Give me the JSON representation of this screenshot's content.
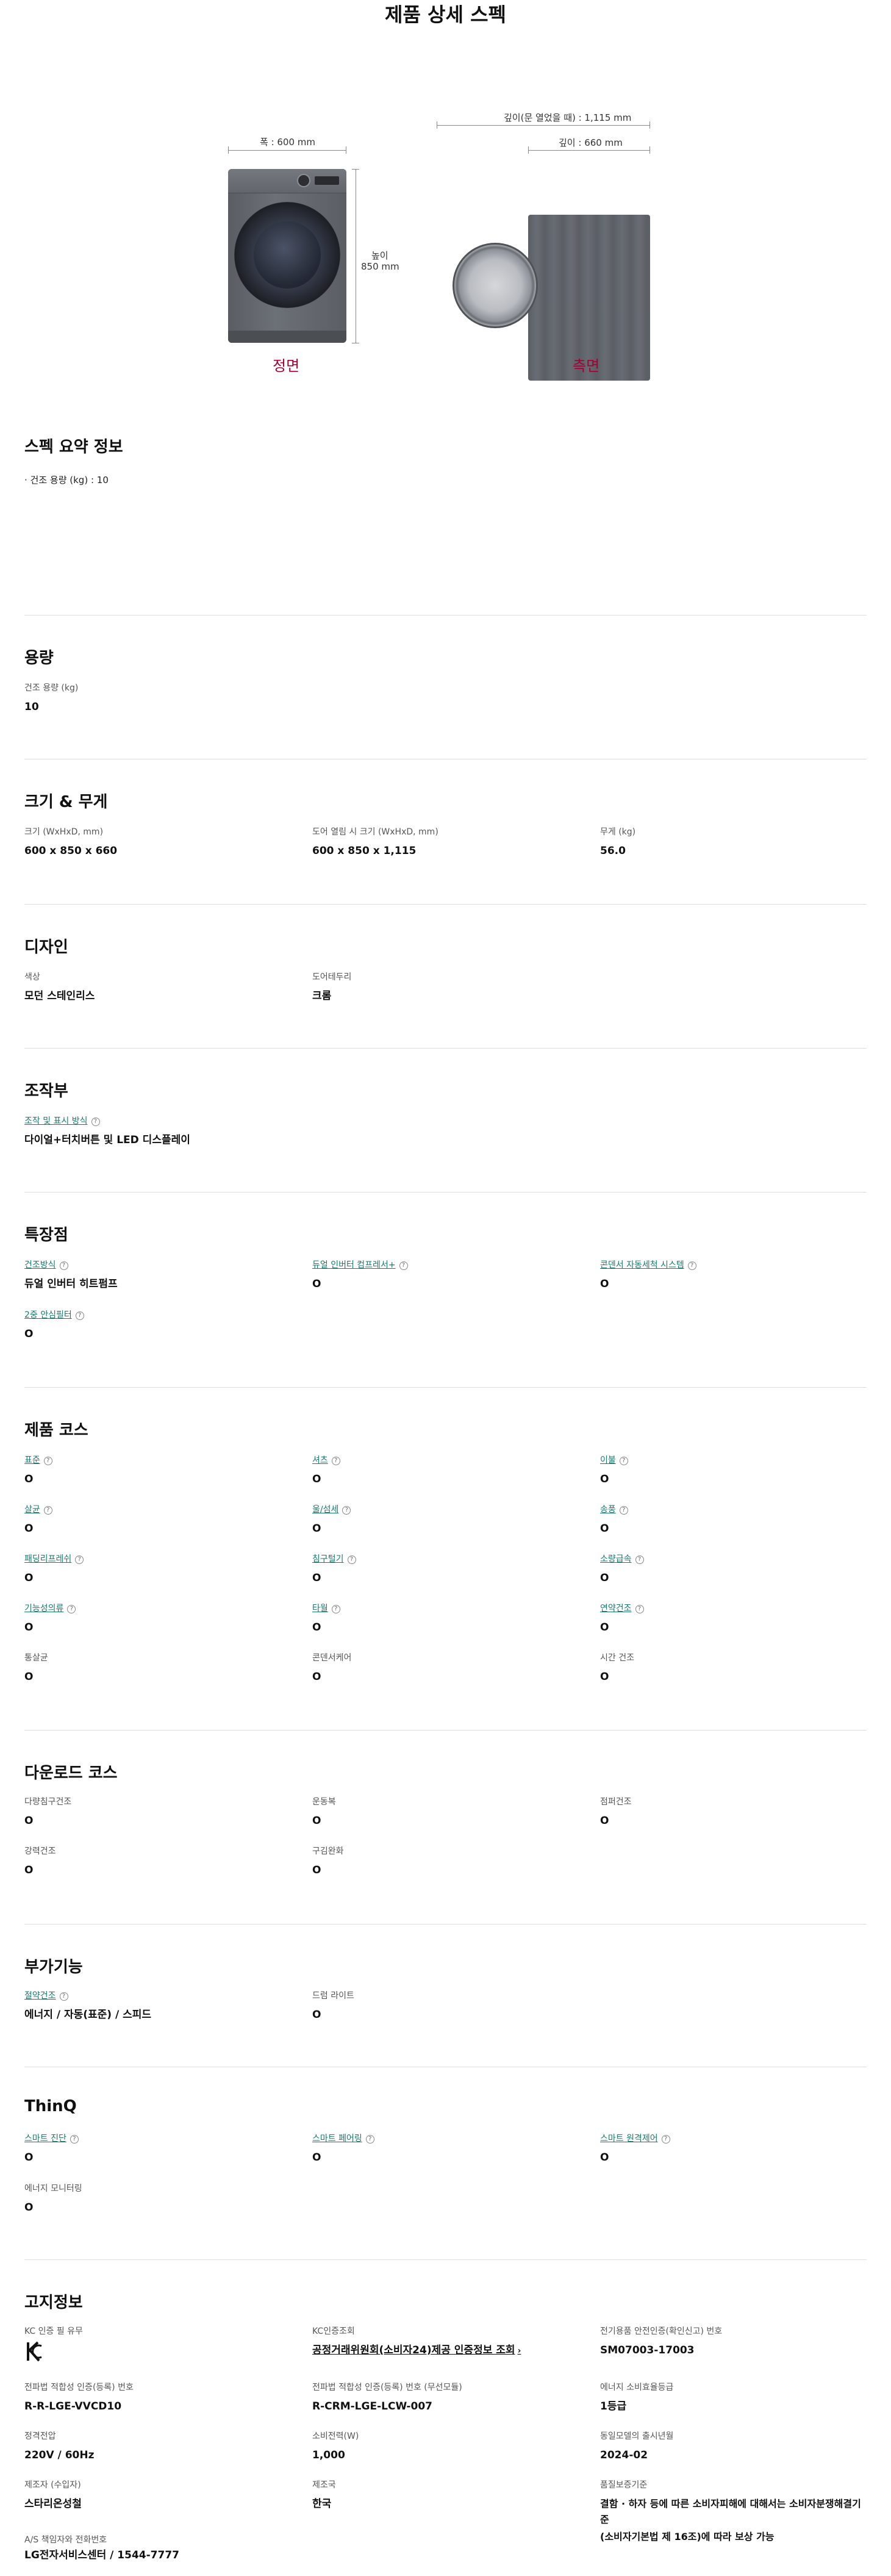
{
  "page_title": "제품 상세 스펙",
  "product_views": {
    "front": {
      "caption": "정면",
      "width_label": "폭 : 600 mm",
      "height_label_1": "높이",
      "height_label_2": "850 mm"
    },
    "side": {
      "caption": "측면",
      "depth_open_label": "깊이(문 열었을 때) : 1,115 mm",
      "depth_label": "깊이 : 660 mm"
    }
  },
  "summary": {
    "title": "스펙 요약 정보",
    "items": [
      "· 건조 용량 (kg) : 10"
    ]
  },
  "capacity": {
    "title": "용량",
    "items": [
      {
        "label": "건조 용량 (kg)",
        "value": "10"
      }
    ]
  },
  "size_weight": {
    "title": "크기 & 무게",
    "items": [
      {
        "label": "크기 (WxHxD, mm)",
        "value": "600 x 850 x 660"
      },
      {
        "label": "도어 열림 시 크기 (WxHxD, mm)",
        "value": "600 x 850 x 1,115"
      },
      {
        "label": "무게 (kg)",
        "value": "56.0"
      }
    ]
  },
  "design": {
    "title": "디자인",
    "items": [
      {
        "label": "색상",
        "value": "모던 스테인리스"
      },
      {
        "label": "도어테두리",
        "value": "크롬"
      }
    ]
  },
  "controls": {
    "title": "조작부",
    "items": [
      {
        "label": "조작 및 표시 방식",
        "value": "다이얼+터치버튼 및 LED 디스플레이"
      }
    ]
  },
  "features": {
    "title": "특장점",
    "items": [
      {
        "label": "건조방식",
        "value": "듀얼 인버터 히트펌프"
      },
      {
        "label": "듀얼 인버터 컴프레서+",
        "value": "O"
      },
      {
        "label": "콘덴서 자동세척 시스템",
        "value": "O"
      },
      {
        "label": "2중 안심필터",
        "value": "O"
      }
    ]
  },
  "courses": {
    "title": "제품 코스",
    "items": [
      {
        "label": "표준",
        "value": "O",
        "link": true
      },
      {
        "label": "셔츠",
        "value": "O",
        "link": true
      },
      {
        "label": "이불",
        "value": "O",
        "link": true
      },
      {
        "label": "살균",
        "value": "O",
        "link": true
      },
      {
        "label": "울/섬세",
        "value": "O",
        "link": true
      },
      {
        "label": "송풍",
        "value": "O",
        "link": true
      },
      {
        "label": "패딩리프레쉬",
        "value": "O",
        "link": true
      },
      {
        "label": "침구털기",
        "value": "O",
        "link": true
      },
      {
        "label": "소량급속",
        "value": "O",
        "link": true
      },
      {
        "label": "기능성의류",
        "value": "O",
        "link": true
      },
      {
        "label": "타월",
        "value": "O",
        "link": true
      },
      {
        "label": "연약건조",
        "value": "O",
        "link": true
      },
      {
        "label": "통살균",
        "value": "O",
        "link": false
      },
      {
        "label": "콘덴서케어",
        "value": "O",
        "link": false
      },
      {
        "label": "시간 건조",
        "value": "O",
        "link": false
      }
    ]
  },
  "download_courses": {
    "title": "다운로드 코스",
    "items": [
      {
        "label": "다량침구건조",
        "value": "O"
      },
      {
        "label": "운동복",
        "value": "O"
      },
      {
        "label": "점퍼건조",
        "value": "O"
      },
      {
        "label": "강력건조",
        "value": "O"
      },
      {
        "label": "구김완화",
        "value": "O"
      }
    ]
  },
  "extras": {
    "title": "부가기능",
    "items": [
      {
        "label": "절약건조",
        "value": "에너지 / 자동(표준) / 스피드",
        "link": true
      },
      {
        "label": "드럼 라이트",
        "value": "O",
        "link": false
      }
    ]
  },
  "thinq": {
    "title": "ThinQ",
    "items": [
      {
        "label": "스마트 진단",
        "value": "O",
        "link": true
      },
      {
        "label": "스마트 페어링",
        "value": "O",
        "link": true
      },
      {
        "label": "스마트 원격제어",
        "value": "O",
        "link": true
      },
      {
        "label": "에너지 모니터링",
        "value": "O",
        "link": false
      }
    ]
  },
  "notice": {
    "title": "고지정보",
    "items": [
      {
        "label": "KC 인증 필 유무",
        "value": "KC"
      },
      {
        "label": "KC인증조회",
        "value": "공정거래위원회(소비자24)제공 인증정보 조회"
      },
      {
        "label": "전기용품 안전인증(확인신고) 번호",
        "value": "SM07003-17003"
      },
      {
        "label": "전파법 적합성 인증(등록) 번호",
        "value": "R-R-LGE-VVCD10"
      },
      {
        "label": "전파법 적합성 인증(등록) 번호 (무선모듈)",
        "value": "R-CRM-LGE-LCW-007"
      },
      {
        "label": "에너지 소비효율등급",
        "value": "1등급"
      },
      {
        "label": "정격전압",
        "value": "220V / 60Hz"
      },
      {
        "label": "소비전력(W)",
        "value": "1,000"
      },
      {
        "label": "동일모델의 출시년월",
        "value": "2024-02"
      },
      {
        "label": "제조자 (수입자)",
        "value": "스타리온성철"
      },
      {
        "label": "제조국",
        "value": "한국"
      },
      {
        "label": "품질보증기준",
        "value_1": "결함 · 하자 등에 따른 소비자피해에 대해서는 소비자분쟁해결기준",
        "value_2": "(소비자기본법 제 16조)에 따라 보상 가능"
      },
      {
        "label": "A/S 책임자와 전화번호",
        "value": "LG전자서비스센터 / 1544-7777"
      }
    ]
  }
}
